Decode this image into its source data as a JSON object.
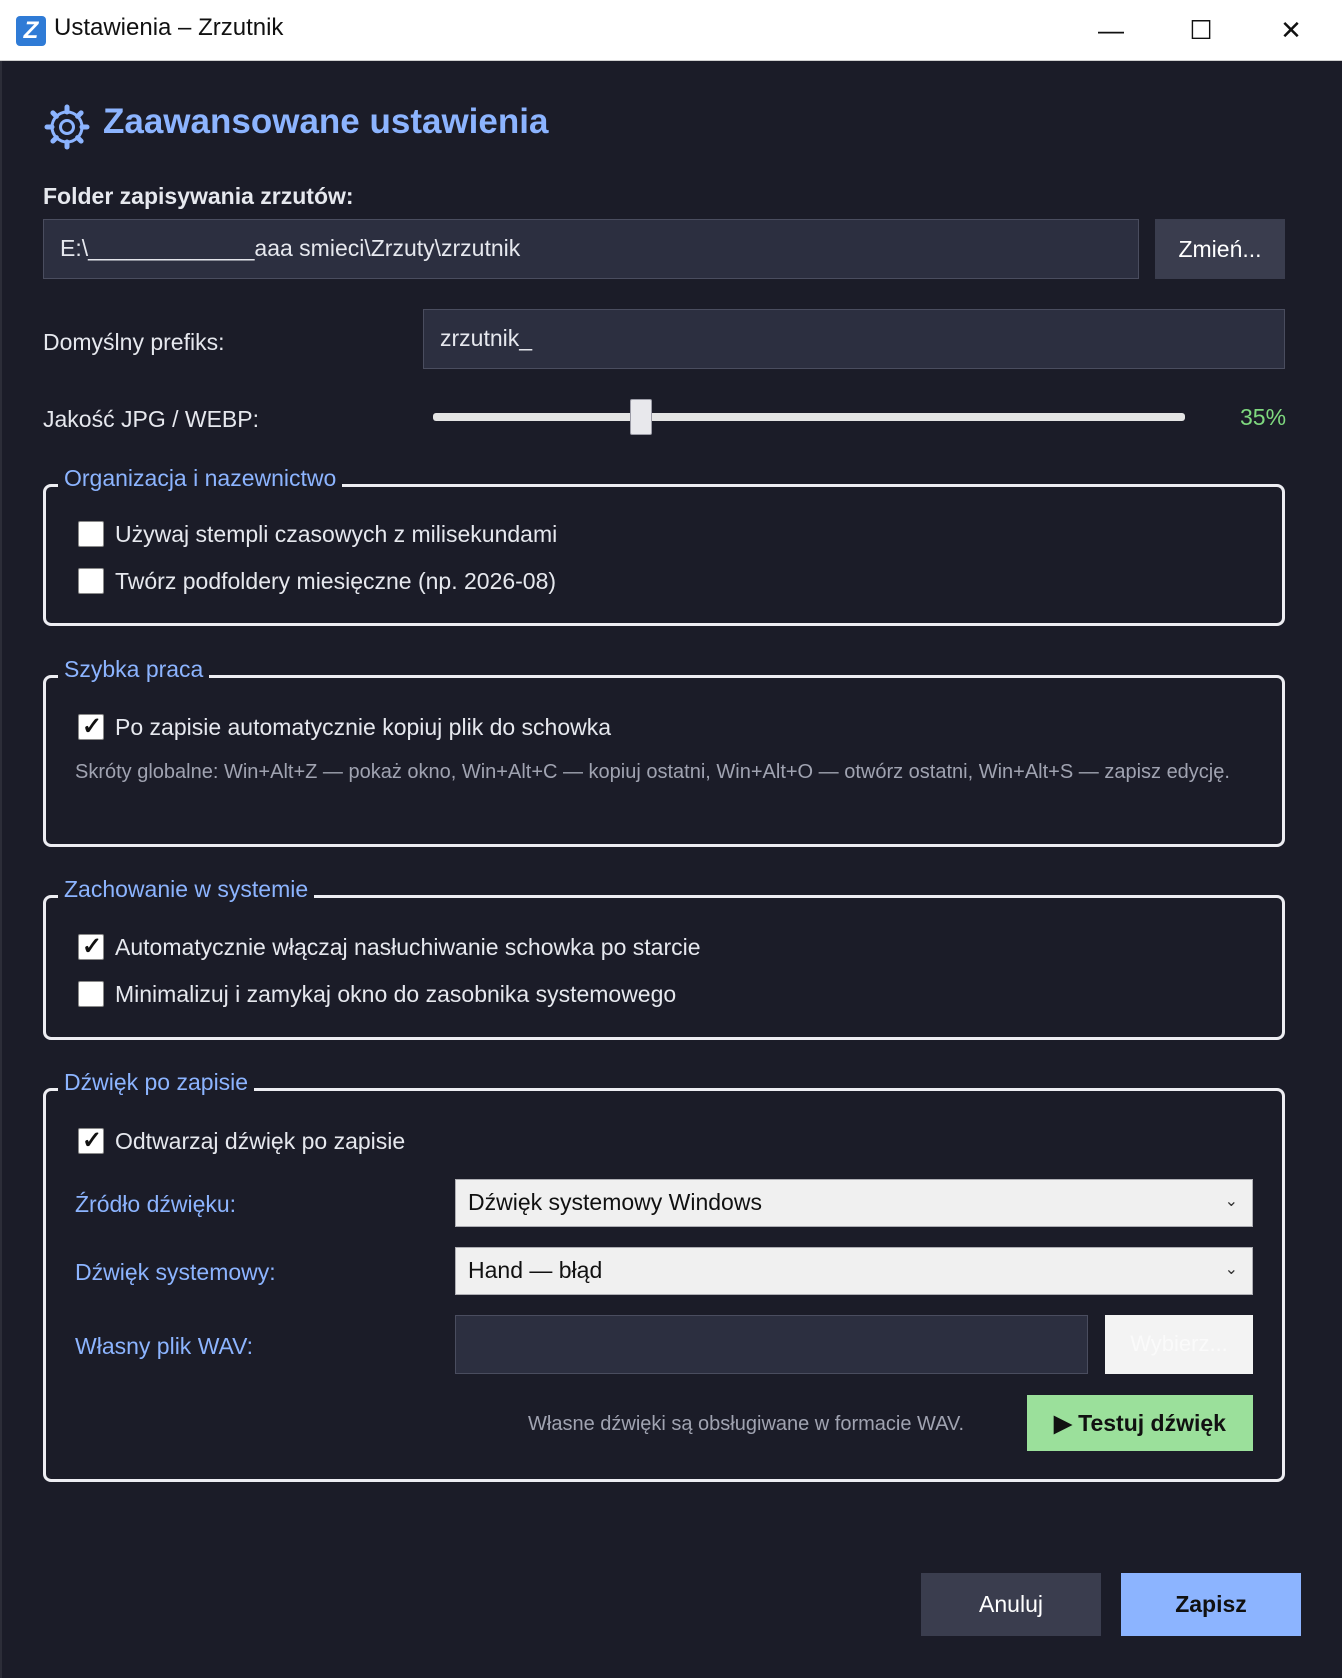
{
  "window": {
    "title": "Ustawienia – Zrzutnik",
    "icon_letter": "Z",
    "minimize_glyph": "—",
    "maximize_glyph": "☐",
    "close_glyph": "✕"
  },
  "heading": "Zaawansowane ustawienia",
  "folder": {
    "label": "Folder zapisywania zrzutów:",
    "value": "E:\\_____________aaa smieci\\Zrzuty\\zrzutnik",
    "change_button": "Zmień..."
  },
  "prefix": {
    "label": "Domyślny prefiks:",
    "value": "zrzutnik_"
  },
  "quality": {
    "label": "Jakość JPG / WEBP:",
    "value_text": "35%",
    "value": 35
  },
  "groups": {
    "organization": {
      "title": "Organizacja i nazewnictwo",
      "options": [
        {
          "label": "Używaj stempli czasowych z milisekundami",
          "checked": false
        },
        {
          "label": "Twórz podfoldery miesięczne (np. 2026-08)",
          "checked": false
        }
      ]
    },
    "quick": {
      "title": "Szybka praca",
      "option": {
        "label": "Po zapisie automatycznie kopiuj plik do schowka",
        "checked": true
      },
      "hint": "Skróty globalne: Win+Alt+Z — pokaż okno, Win+Alt+C — kopiuj ostatni, Win+Alt+O — otwórz ostatni, Win+Alt+S — zapisz edycję."
    },
    "system": {
      "title": "Zachowanie w systemie",
      "options": [
        {
          "label": "Automatycznie włączaj nasłuchiwanie schowka po starcie",
          "checked": true
        },
        {
          "label": "Minimalizuj i zamykaj okno do zasobnika systemowego",
          "checked": false
        }
      ]
    },
    "sound": {
      "title": "Dźwięk po zapisie",
      "option": {
        "label": "Odtwarzaj dźwięk po zapisie",
        "checked": true
      },
      "source_label": "Źródło dźwięku:",
      "source_value": "Dźwięk systemowy Windows",
      "system_label": "Dźwięk systemowy:",
      "system_value": "Hand — błąd",
      "wav_label": "Własny plik WAV:",
      "wav_value": "",
      "wav_button": "Wybierz...",
      "hint": "Własne dźwięki są obsługiwane w formacie WAV.",
      "test_button": "▶ Testuj dźwięk"
    }
  },
  "footer": {
    "cancel": "Anuluj",
    "save": "Zapisz"
  },
  "colors": {
    "background": "#1b1c28",
    "accent": "#8cb4ff",
    "success": "#9be09b",
    "slider_value": "#7fd97f"
  }
}
